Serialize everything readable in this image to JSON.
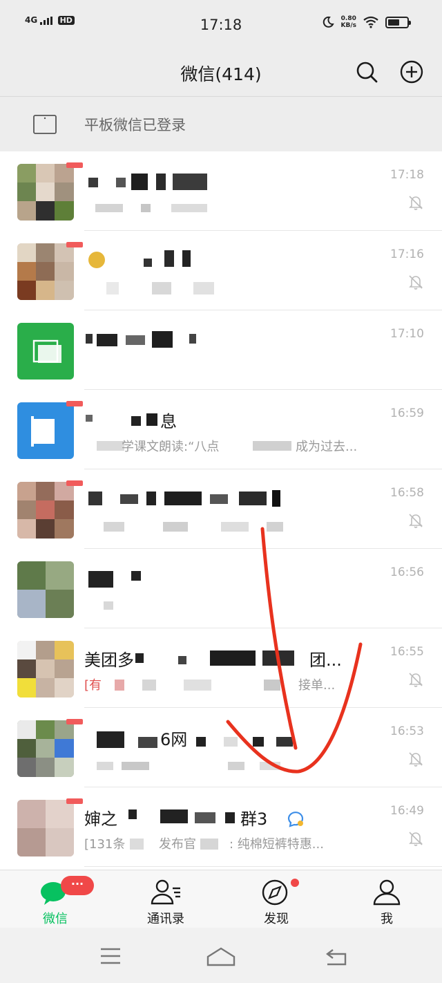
{
  "status_bar": {
    "network": "4G",
    "hd": "HD",
    "time": "17:18",
    "speed_value": "0.80",
    "speed_unit": "KB/s",
    "battery_level": 0.6
  },
  "header": {
    "title": "微信(414)",
    "search_icon": "search-icon",
    "add_icon": "plus-circle-icon"
  },
  "device_banner": {
    "label": "平板微信已登录",
    "icon": "tablet-icon"
  },
  "chats": [
    {
      "title": "",
      "preview": "",
      "time": "17:18",
      "muted": true
    },
    {
      "title": "",
      "preview": "",
      "time": "17:16",
      "muted": true
    },
    {
      "title": "",
      "preview": "",
      "time": "17:10",
      "muted": false
    },
    {
      "title": "息",
      "preview": "学课文朗读:“八点",
      "preview2": "成为过去...",
      "time": "16:59",
      "muted": false
    },
    {
      "title": "",
      "preview": "",
      "time": "16:58",
      "muted": true
    },
    {
      "title": "",
      "preview": "",
      "time": "16:56",
      "muted": false
    },
    {
      "title": "美团多",
      "title2": "团...",
      "preview_alert": "[有",
      "preview": "接单...",
      "time": "16:55",
      "muted": true
    },
    {
      "title": "6网",
      "preview": "",
      "time": "16:53",
      "muted": true
    },
    {
      "title": "婶之",
      "title2": "群3",
      "preview": "[131条",
      "preview2": "发布官",
      "preview3": ": 纯棉短裤特惠...",
      "time": "16:49",
      "muted": true
    }
  ],
  "tabs": [
    {
      "label": "微信",
      "icon": "chat-bubble-icon",
      "active": true,
      "badge": "···"
    },
    {
      "label": "通讯录",
      "icon": "contacts-icon",
      "active": false
    },
    {
      "label": "发现",
      "icon": "compass-icon",
      "active": false,
      "dot": true
    },
    {
      "label": "我",
      "icon": "person-icon",
      "active": false
    }
  ],
  "system_nav": {
    "menu_icon": "menu-icon",
    "home_icon": "home-icon",
    "back_icon": "back-icon"
  },
  "colors": {
    "accent": "#07c160",
    "badge": "#f04848",
    "annotation": "#e8321e"
  }
}
